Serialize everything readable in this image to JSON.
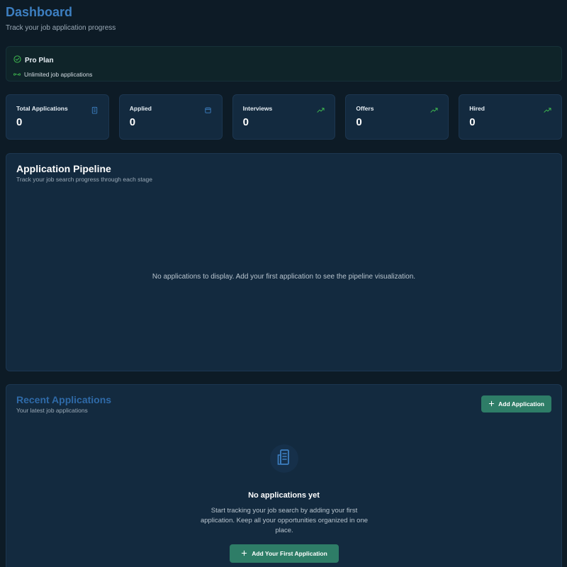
{
  "header": {
    "title": "Dashboard",
    "subtitle": "Track your job application progress"
  },
  "plan": {
    "name": "Pro Plan",
    "feature": "Unlimited job applications",
    "icon": "check-circle-icon",
    "feature_icon": "infinity-icon"
  },
  "stats": [
    {
      "label": "Total Applications",
      "value": "0",
      "icon": "building-icon"
    },
    {
      "label": "Applied",
      "value": "0",
      "icon": "calendar-icon"
    },
    {
      "label": "Interviews",
      "value": "0",
      "icon": "trending-up-icon"
    },
    {
      "label": "Offers",
      "value": "0",
      "icon": "trending-up-icon"
    },
    {
      "label": "Hired",
      "value": "0",
      "icon": "trending-up-icon"
    }
  ],
  "pipeline": {
    "title": "Application Pipeline",
    "subtitle": "Track your job search progress through each stage",
    "empty_text": "No applications to display. Add your first application to see the pipeline visualization."
  },
  "recent": {
    "title": "Recent Applications",
    "subtitle": "Your latest job applications",
    "add_button": "Add Application",
    "empty_title": "No applications yet",
    "empty_desc": "Start tracking your job search by adding your first application. Keep all your opportunities organized in one place.",
    "first_button": "Add Your First Application"
  },
  "colors": {
    "background": "#0d1b26",
    "card": "#132a3f",
    "accent_blue": "#3d7fc1",
    "accent_green": "#2e7d67",
    "trend_green": "#3fb950"
  }
}
